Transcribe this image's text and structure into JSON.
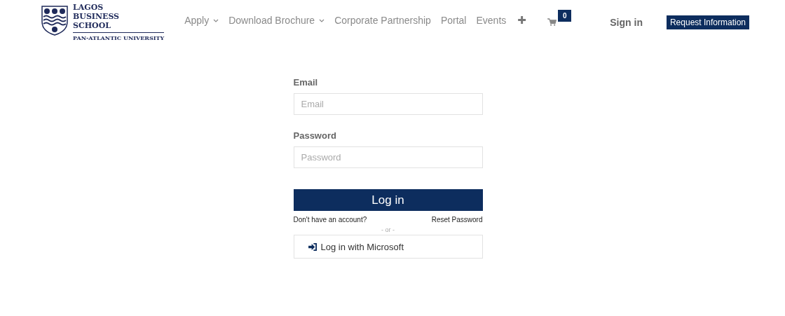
{
  "logo": {
    "lines": [
      "LAGOS",
      "BUSINESS",
      "SCHOOL"
    ],
    "subtitle": "PAN-ATLANTIC UNIVERSITY"
  },
  "nav": [
    {
      "label": "Apply",
      "dropdown": true
    },
    {
      "label": "Download Brochure",
      "dropdown": true
    },
    {
      "label": "Corporate Partnership",
      "dropdown": false
    },
    {
      "label": "Portal",
      "dropdown": false
    },
    {
      "label": "Events",
      "dropdown": false
    }
  ],
  "more_button": "✚",
  "cart": {
    "count": "0"
  },
  "sign_in": "Sign in",
  "request_button": "Request Information",
  "form": {
    "email_label": "Email",
    "email_placeholder": "Email",
    "password_label": "Password",
    "password_placeholder": "Password",
    "login_button": "Log in",
    "signup_link": "Don't have an account?",
    "reset_link": "Reset Password",
    "separator": "- or -",
    "microsoft_button": "Log in with Microsoft"
  }
}
